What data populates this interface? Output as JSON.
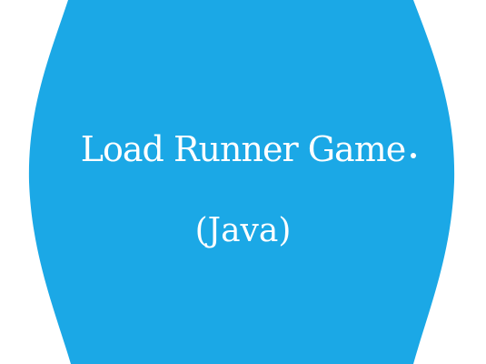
{
  "slide": {
    "title": "Load Runner Game",
    "subtitle": "(Java)"
  },
  "colors": {
    "background": "#1ba8e6",
    "edge_curves": "#ffffff",
    "text": "#ffffff"
  }
}
